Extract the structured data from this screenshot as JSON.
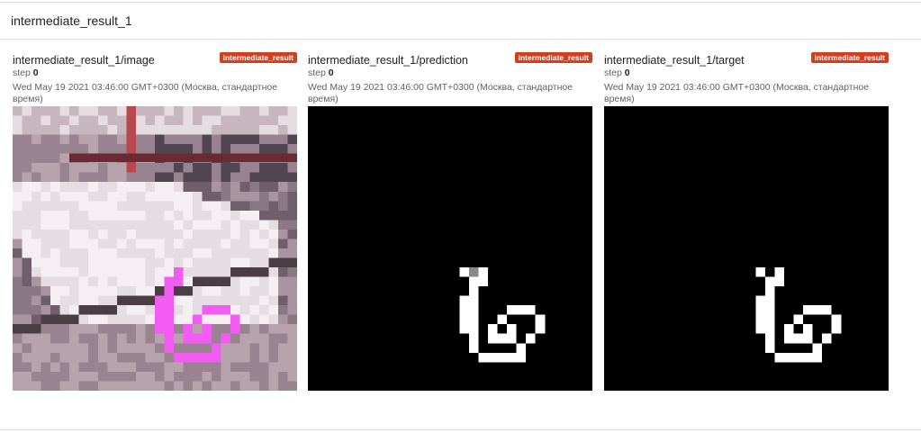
{
  "group": {
    "title": "intermediate_result_1"
  },
  "cards": [
    {
      "title": "intermediate_result_1/image",
      "run": "intermediate_result",
      "step_label": "step",
      "step_value": "0",
      "timestamp": "Wed May 19 2021 03:46:00 GMT+0300 (Москва, стандартное время)"
    },
    {
      "title": "intermediate_result_1/prediction",
      "run": "intermediate_result",
      "step_label": "step",
      "step_value": "0",
      "timestamp": "Wed May 19 2021 03:46:00 GMT+0300 (Москва, стандартное время)"
    },
    {
      "title": "intermediate_result_1/target",
      "run": "intermediate_result",
      "step_label": "step",
      "step_value": "0",
      "timestamp": "Wed May 19 2021 03:46:00 GMT+0300 (Москва, стандартное время)"
    }
  ],
  "colors": {
    "badge": "#d23f1f",
    "mask_bg": "#000000",
    "mask_fg": "#ffffff",
    "overlay": "#f25cf2"
  }
}
